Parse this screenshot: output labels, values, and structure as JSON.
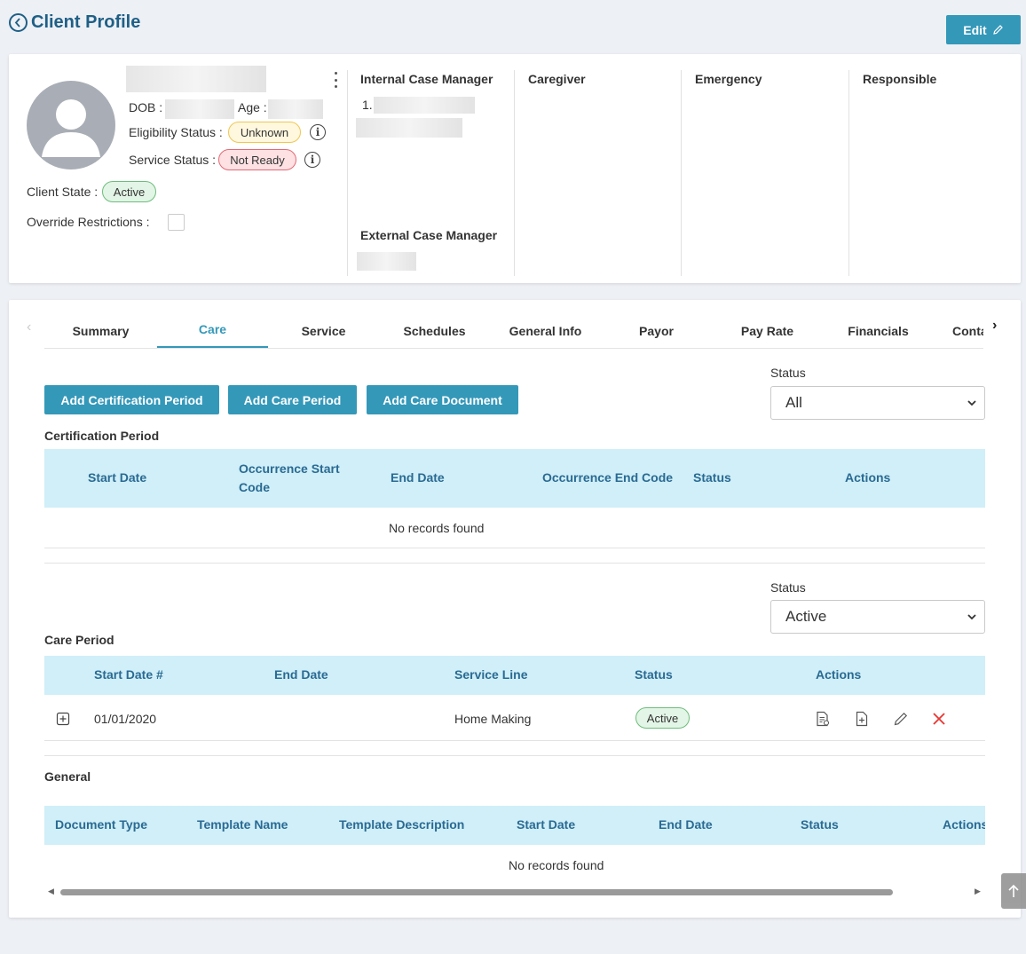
{
  "header": {
    "title": "Client Profile",
    "edit_label": "Edit"
  },
  "profile": {
    "dob_label": "DOB :",
    "age_label": "Age :",
    "eligibility_label": "Eligibility Status :",
    "eligibility_value": "Unknown",
    "service_status_label": "Service Status :",
    "service_status_value": "Not Ready",
    "client_state_label": "Client State :",
    "client_state_value": "Active",
    "override_label": "Override Restrictions :",
    "internal_cm_title": "Internal Case Manager",
    "internal_cm_item_prefix": "1.",
    "external_cm_title": "External Case Manager",
    "caregiver_title": "Caregiver",
    "emergency_title": "Emergency",
    "responsible_title": "Responsible"
  },
  "tabs": [
    {
      "label": "Summary"
    },
    {
      "label": "Care",
      "active": true
    },
    {
      "label": "Service"
    },
    {
      "label": "Schedules"
    },
    {
      "label": "General Info"
    },
    {
      "label": "Payor"
    },
    {
      "label": "Pay Rate"
    },
    {
      "label": "Financials"
    },
    {
      "label": "Conta"
    }
  ],
  "actions": {
    "add_certification": "Add Certification Period",
    "add_care_period": "Add Care Period",
    "add_care_document": "Add Care Document"
  },
  "certification": {
    "status_label": "Status",
    "status_value": "All",
    "title": "Certification Period",
    "columns": [
      "Start Date",
      "Occurrence Start Code",
      "End Date",
      "Occurrence End Code",
      "Status",
      "Actions"
    ],
    "empty": "No records found"
  },
  "care_period": {
    "status_label": "Status",
    "status_value": "Active",
    "title": "Care Period",
    "columns": [
      "Start Date #",
      "End Date",
      "Service Line",
      "Status",
      "Actions"
    ],
    "rows": [
      {
        "start": "01/01/2020",
        "end": "",
        "service_line": "Home Making",
        "status": "Active"
      }
    ]
  },
  "general": {
    "title": "General",
    "columns": [
      "Document Type",
      "Template Name",
      "Template Description",
      "Start Date",
      "End Date",
      "Status",
      "Actions"
    ],
    "empty": "No records found"
  },
  "colors": {
    "accent": "#3498b9",
    "title": "#1f5f86",
    "table_header_bg": "#d0eff8",
    "delete": "#e53935"
  }
}
